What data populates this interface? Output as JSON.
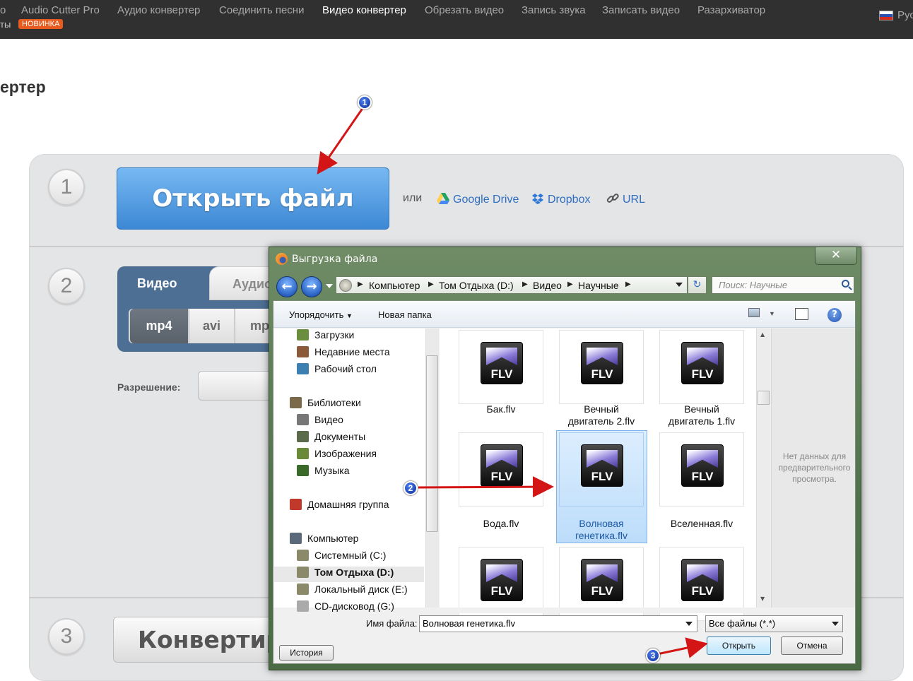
{
  "topnav": {
    "items": [
      "о",
      "Audio Cutter Pro",
      "Аудио конвертер",
      "Соединить песни",
      "Видео конвертер",
      "Обрезать видео",
      "Запись звука",
      "Записать видео",
      "Разархиватор"
    ],
    "active_item": "Видео конвертер",
    "row2_text": "ты",
    "new_badge": "НОВИНКА",
    "language": "Рус"
  },
  "page_title": "ертер",
  "step1": {
    "number": "1",
    "open_button": "Открыть файл",
    "or_text": "или",
    "sources": [
      {
        "label": "Google Drive",
        "icon": "google-drive-icon"
      },
      {
        "label": "Dropbox",
        "icon": "dropbox-icon"
      },
      {
        "label": "URL",
        "icon": "link-icon"
      }
    ]
  },
  "step2": {
    "number": "2",
    "tabs": [
      "Видео",
      "Аудио"
    ],
    "formats": [
      "mp4",
      "avi",
      "mp"
    ],
    "selected_format": "mp4",
    "resolution_label": "Разрешение:"
  },
  "step3": {
    "number": "3",
    "convert_button": "Конвертир"
  },
  "dialog": {
    "title": "Выгрузка файла",
    "close": "✕",
    "breadcrumbs": [
      "Компьютер",
      "Том Отдыха (D:)",
      "Видео",
      "Научные"
    ],
    "search_placeholder": "Поиск: Научные",
    "toolbar": {
      "organize": "Упорядочить",
      "new_folder": "Новая папка"
    },
    "help": "?",
    "nav_items": [
      {
        "label": "Загрузки",
        "icon": "downloads-folder-icon",
        "color": "#6b8e3e"
      },
      {
        "label": "Недавние места",
        "icon": "recent-places-icon",
        "color": "#8a5a3a"
      },
      {
        "label": "Рабочий стол",
        "icon": "desktop-icon",
        "color": "#3d7fb0"
      },
      {
        "label": "Библиотеки",
        "icon": "libraries-icon",
        "color": "#7a6a4a"
      },
      {
        "label": "Видео",
        "icon": "video-library-icon",
        "color": "#777777"
      },
      {
        "label": "Документы",
        "icon": "documents-icon",
        "color": "#5a6a4a"
      },
      {
        "label": "Изображения",
        "icon": "pictures-icon",
        "color": "#6a8a3a"
      },
      {
        "label": "Музыка",
        "icon": "music-icon",
        "color": "#3a6a2a"
      },
      {
        "label": "Домашняя группа",
        "icon": "homegroup-icon",
        "color": "#c0392b"
      },
      {
        "label": "Компьютер",
        "icon": "computer-icon",
        "color": "#5a6a7a"
      },
      {
        "label": "Системный (C:)",
        "icon": "drive-c-icon",
        "color": "#8a8a6a"
      },
      {
        "label": "Том Отдыха (D:)",
        "icon": "drive-d-icon",
        "color": "#8a8a6a"
      },
      {
        "label": "Локальный диск (E:)",
        "icon": "drive-e-icon",
        "color": "#8a8a6a"
      },
      {
        "label": "CD-дисковод (G:)",
        "icon": "cd-drive-icon",
        "color": "#aaaaaa"
      }
    ],
    "selected_nav": "Том Отдыха (D:)",
    "files": [
      {
        "name": "Бак.flv"
      },
      {
        "name": "Вечный двигатель 2.flv"
      },
      {
        "name": "Вечный двигатель 1.flv"
      },
      {
        "name": "Вода.flv"
      },
      {
        "name": "Волновая генетика.flv"
      },
      {
        "name": "Вселенная.flv"
      },
      {
        "name": ""
      },
      {
        "name": ""
      },
      {
        "name": ""
      }
    ],
    "file_icon_text": "FLV",
    "selected_file": "Волновая генетика.flv",
    "preview_text": "Нет данных для предварительного просмотра.",
    "filename_label": "Имя файла:",
    "filename_value": "Волновая генетика.flv",
    "filter_value": "Все файлы (*.*)",
    "open_button": "Открыть",
    "cancel_button": "Отмена",
    "history_button": "История"
  },
  "annotations": [
    "1",
    "2",
    "3"
  ],
  "colors": {
    "accent_blue": "#3d88d4",
    "arrow_red": "#d31515",
    "dialog_frame": "#50724a",
    "badge_orange": "#e85b1e"
  }
}
